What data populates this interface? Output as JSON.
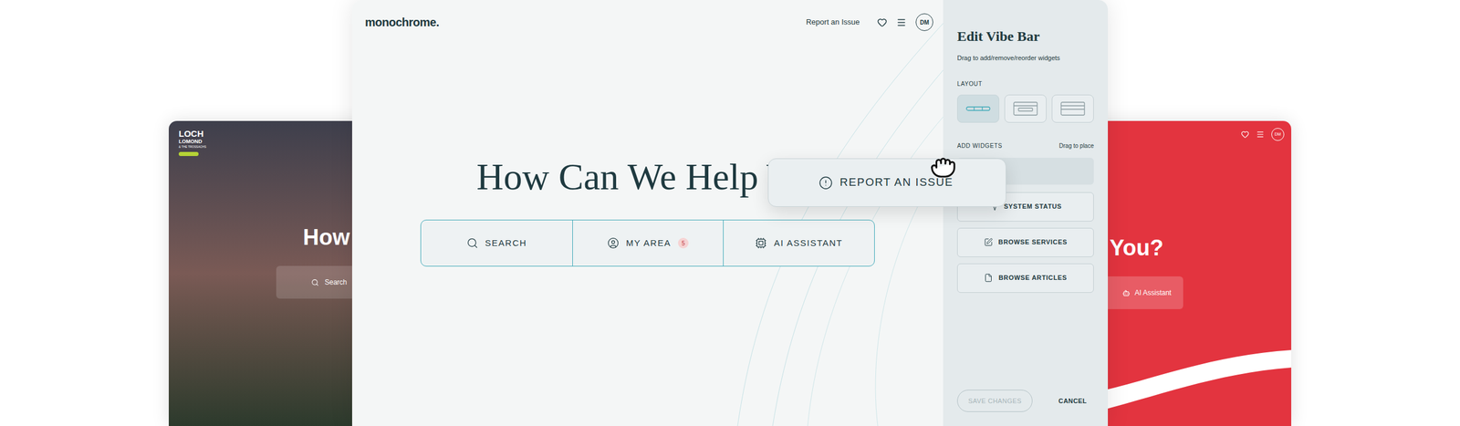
{
  "left_card": {
    "logo": [
      "LOCH",
      "LOMOND",
      "& THE TROSSACHS"
    ],
    "heading": "How",
    "button": "Search"
  },
  "main_card": {
    "logo": "monochrome.",
    "nav": {
      "link": "Report an Issue",
      "avatar": "DM"
    },
    "heading": "How Can We Help Y",
    "vibe_bar": [
      {
        "label": "SEARCH",
        "kind": "search"
      },
      {
        "label": "MY AREA",
        "kind": "area",
        "badge": "5"
      },
      {
        "label": "AI ASSISTANT",
        "kind": "ai"
      }
    ],
    "dragged_widget": "REPORT AN ISSUE"
  },
  "panel": {
    "title": "Edit Vibe Bar",
    "subtitle": "Drag to add/remove/reorder widgets",
    "layout_label": "LAYOUT",
    "layouts": [
      {
        "kind": "bar",
        "selected": true
      },
      {
        "kind": "header",
        "selected": false
      },
      {
        "kind": "banner",
        "selected": false
      }
    ],
    "widgets_label": "ADD WIDGETS",
    "widgets_hint": "Drag to place",
    "widgets": [
      {
        "label": "SYSTEM STATUS",
        "kind": "status"
      },
      {
        "label": "BROWSE SERVICES",
        "kind": "services"
      },
      {
        "label": "BROWSE ARTICLES",
        "kind": "articles"
      }
    ],
    "save": {
      "label": "SAVE CHANGES",
      "disabled": true
    },
    "cancel": "CANCEL"
  },
  "right_card": {
    "avatar": "DM",
    "heading": "You?",
    "button": "AI Assistant"
  }
}
